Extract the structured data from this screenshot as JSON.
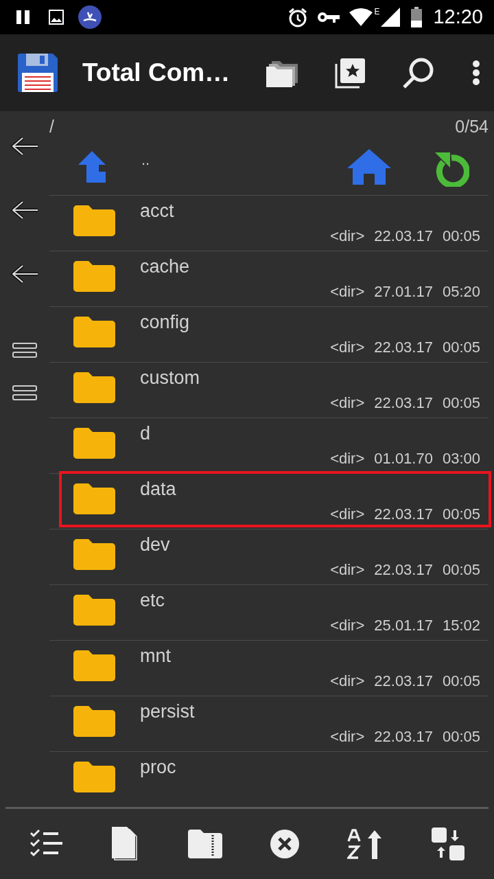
{
  "status_bar": {
    "network_type": "E",
    "time": "12:20"
  },
  "toolbar": {
    "title": "Total Com…"
  },
  "panel": {
    "path": "/",
    "selection_count": "0/54",
    "parent_label": "..",
    "rows": [
      {
        "name": "acct",
        "type": "<dir>",
        "date": "22.03.17",
        "time": "00:05",
        "highlighted": false
      },
      {
        "name": "cache",
        "type": "<dir>",
        "date": "27.01.17",
        "time": "05:20",
        "highlighted": false
      },
      {
        "name": "config",
        "type": "<dir>",
        "date": "22.03.17",
        "time": "00:05",
        "highlighted": false
      },
      {
        "name": "custom",
        "type": "<dir>",
        "date": "22.03.17",
        "time": "00:05",
        "highlighted": false
      },
      {
        "name": "d",
        "type": "<dir>",
        "date": "01.01.70",
        "time": "03:00",
        "highlighted": false
      },
      {
        "name": "data",
        "type": "<dir>",
        "date": "22.03.17",
        "time": "00:05",
        "highlighted": true
      },
      {
        "name": "dev",
        "type": "<dir>",
        "date": "22.03.17",
        "time": "00:05",
        "highlighted": false
      },
      {
        "name": "etc",
        "type": "<dir>",
        "date": "25.01.17",
        "time": "15:02",
        "highlighted": false
      },
      {
        "name": "mnt",
        "type": "<dir>",
        "date": "22.03.17",
        "time": "00:05",
        "highlighted": false
      },
      {
        "name": "persist",
        "type": "<dir>",
        "date": "22.03.17",
        "time": "00:05",
        "highlighted": false
      },
      {
        "name": "proc",
        "highlighted": false
      }
    ]
  }
}
